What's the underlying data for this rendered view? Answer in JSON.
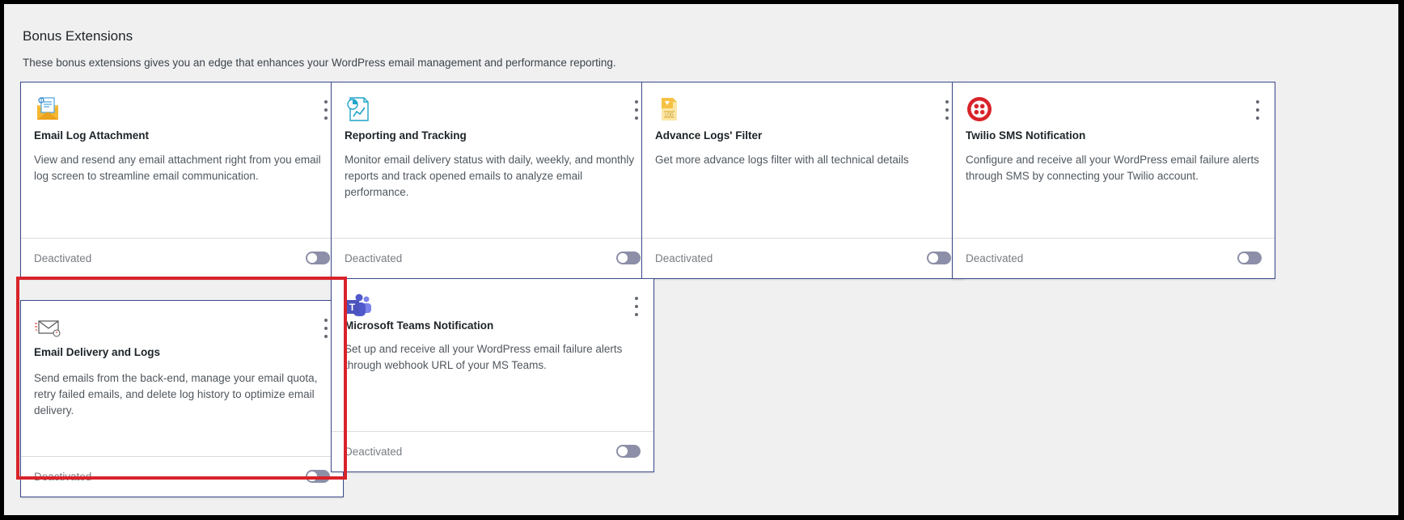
{
  "header": {
    "title": "Bonus Extensions",
    "description": "These bonus extensions gives you an edge that enhances your WordPress email management and performance reporting."
  },
  "cards": [
    {
      "icon": "email-attachment-icon",
      "title": "Email Log Attachment",
      "description": "View and resend any email attachment right from you email log screen to streamline email communication.",
      "status": "Deactivated"
    },
    {
      "icon": "report-chart-icon",
      "title": "Reporting and Tracking",
      "description": "Monitor email delivery status with daily, weekly, and monthly reports and track opened emails to analyze email performance.",
      "status": "Deactivated"
    },
    {
      "icon": "log-file-icon",
      "title": "Advance Logs' Filter",
      "description": "Get more advance logs filter with all technical details",
      "status": "Deactivated"
    },
    {
      "icon": "twilio-logo-icon",
      "title": "Twilio SMS Notification",
      "description": "Configure and receive all your WordPress email failure alerts through SMS by connecting your Twilio account.",
      "status": "Deactivated"
    },
    {
      "icon": "email-delivery-icon",
      "title": "Email Delivery and Logs",
      "description": "Send emails from the back-end, manage your email quota, retry failed emails, and delete log history to optimize email delivery.",
      "status": "Deactivated"
    },
    {
      "icon": "ms-teams-logo-icon",
      "title": "Microsoft Teams Notification",
      "description": "Set up and receive all your WordPress email failure alerts through webhook URL of your MS Teams.",
      "status": "Deactivated"
    }
  ],
  "colors": {
    "card_border": "#3b4a8c",
    "toggle_off": "#8c8fa7",
    "highlight": "#d8232a",
    "twilio_red": "#d8232a",
    "teams_purple": "#5059c9"
  }
}
